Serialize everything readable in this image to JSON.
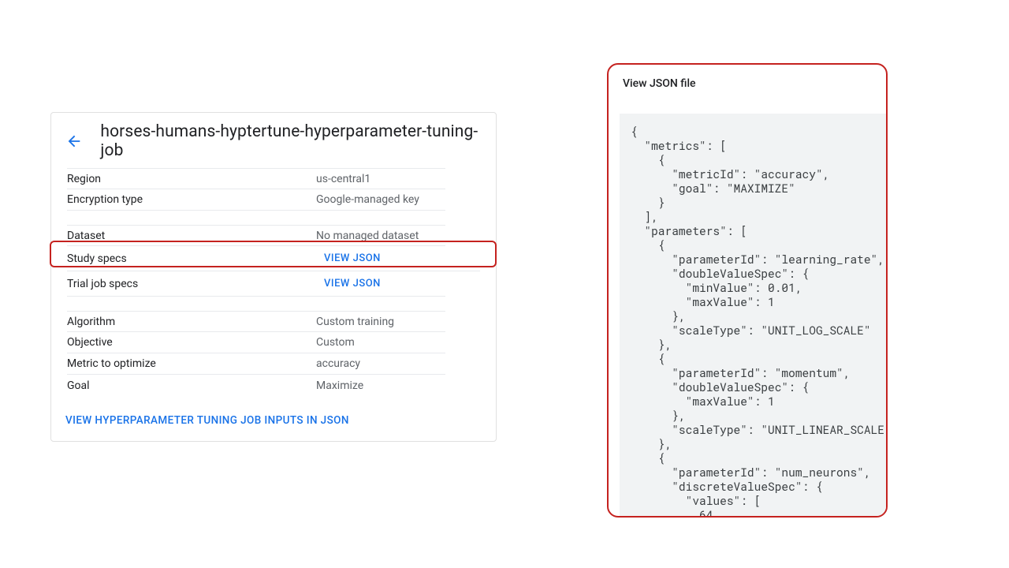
{
  "card": {
    "title": "horses-humans-hyptertune-hyperparameter-tuning-job",
    "rows": {
      "region": {
        "label": "Region",
        "value": "us-central1"
      },
      "encryption": {
        "label": "Encryption type",
        "value": "Google-managed key"
      },
      "dataset": {
        "label": "Dataset",
        "value": "No managed dataset"
      },
      "study_specs": {
        "label": "Study specs",
        "action": "VIEW JSON"
      },
      "trial_specs": {
        "label": "Trial job specs",
        "action": "VIEW JSON"
      },
      "algorithm": {
        "label": "Algorithm",
        "value": "Custom training"
      },
      "objective": {
        "label": "Objective",
        "value": "Custom"
      },
      "metric": {
        "label": "Metric to optimize",
        "value": "accuracy"
      },
      "goal": {
        "label": "Goal",
        "value": "Maximize"
      }
    },
    "footer_link": "VIEW HYPERPARAMETER TUNING JOB INPUTS IN JSON"
  },
  "json_panel": {
    "title": "View JSON file",
    "content": "{\n  \"metrics\": [\n    {\n      \"metricId\": \"accuracy\",\n      \"goal\": \"MAXIMIZE\"\n    }\n  ],\n  \"parameters\": [\n    {\n      \"parameterId\": \"learning_rate\",\n      \"doubleValueSpec\": {\n        \"minValue\": 0.01,\n        \"maxValue\": 1\n      },\n      \"scaleType\": \"UNIT_LOG_SCALE\"\n    },\n    {\n      \"parameterId\": \"momentum\",\n      \"doubleValueSpec\": {\n        \"maxValue\": 1\n      },\n      \"scaleType\": \"UNIT_LINEAR_SCALE\"\n    },\n    {\n      \"parameterId\": \"num_neurons\",\n      \"discreteValueSpec\": {\n        \"values\": [\n          64"
  }
}
